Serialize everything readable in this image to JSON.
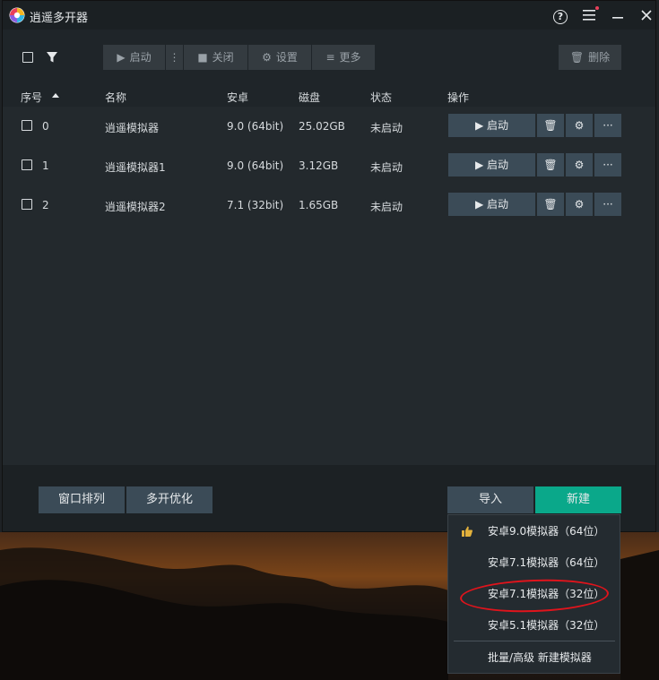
{
  "window": {
    "title": "逍遥多开器"
  },
  "toolbar": {
    "start_label": "启动",
    "close_label": "关闭",
    "settings_label": "设置",
    "more_label": "更多",
    "delete_label": "删除"
  },
  "table": {
    "columns": [
      "序号",
      "名称",
      "安卓",
      "磁盘",
      "状态",
      "操作"
    ],
    "rows": [
      {
        "index": "0",
        "name": "逍遥模拟器",
        "android": "9.0 (64bit)",
        "disk": "25.02GB",
        "status": "未启动",
        "action": "启动"
      },
      {
        "index": "1",
        "name": "逍遥模拟器1",
        "android": "9.0 (64bit)",
        "disk": "3.12GB",
        "status": "未启动",
        "action": "启动"
      },
      {
        "index": "2",
        "name": "逍遥模拟器2",
        "android": "7.1 (32bit)",
        "disk": "1.65GB",
        "status": "未启动",
        "action": "启动"
      }
    ]
  },
  "footer": {
    "arrange_label": "窗口排列",
    "optimize_label": "多开优化",
    "import_label": "导入",
    "new_label": "新建"
  },
  "new_menu": {
    "items": [
      "安卓9.0模拟器（64位）",
      "安卓7.1模拟器（64位）",
      "安卓7.1模拟器（32位）",
      "安卓5.1模拟器（32位）",
      "批量/高级 新建模拟器"
    ]
  },
  "colors": {
    "accent_new": "#0aa88a",
    "button": "#3b4b57",
    "highlight_circle": "#e0141c",
    "notification_dot": "#e8405a"
  }
}
